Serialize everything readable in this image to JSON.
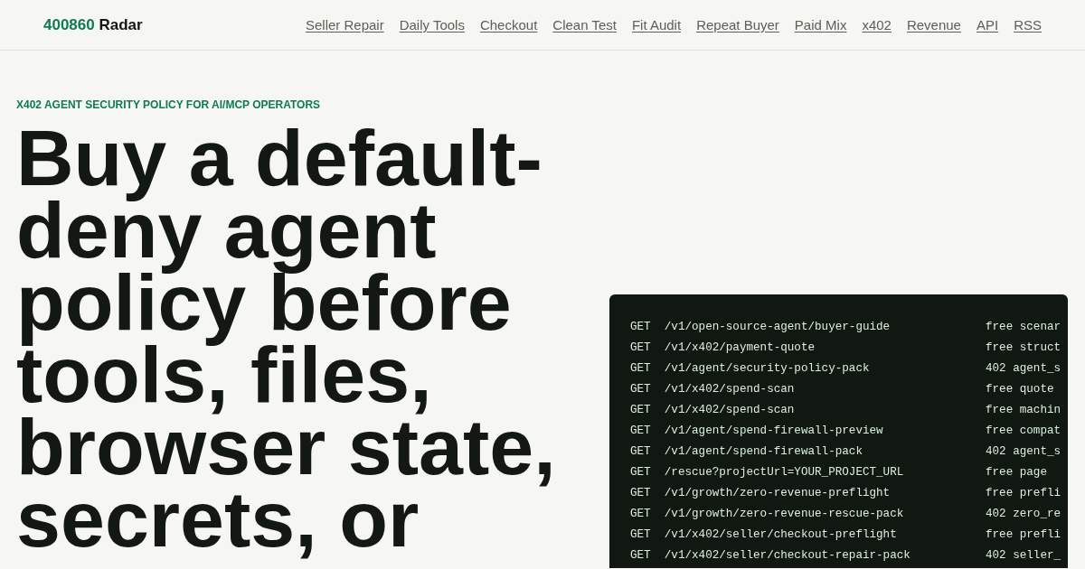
{
  "header": {
    "logo": {
      "number": "400860",
      "name": "Radar"
    },
    "nav": [
      "Seller Repair",
      "Daily Tools",
      "Checkout",
      "Clean Test",
      "Fit Audit",
      "Repeat Buyer",
      "Paid Mix",
      "x402",
      "Revenue",
      "API",
      "RSS"
    ]
  },
  "hero": {
    "eyebrow": "X402 AGENT SECURITY POLICY FOR AI/MCP OPERATORS",
    "heading": "Buy a default-deny agent policy before tools, files, browser state, secrets, or"
  },
  "code_block": {
    "lines": [
      {
        "method": "GET",
        "path": "/v1/open-source-agent/buyer-guide",
        "note": "free scenar"
      },
      {
        "method": "GET",
        "path": "/v1/x402/payment-quote",
        "note": "free struct"
      },
      {
        "method": "GET",
        "path": "/v1/agent/security-policy-pack",
        "note": "402 agent_s"
      },
      {
        "method": "GET",
        "path": "/v1/x402/spend-scan",
        "note": "free quote"
      },
      {
        "method": "GET",
        "path": "/v1/x402/spend-scan",
        "note": "free machin"
      },
      {
        "method": "GET",
        "path": "/v1/agent/spend-firewall-preview",
        "note": "free compat"
      },
      {
        "method": "GET",
        "path": "/v1/agent/spend-firewall-pack",
        "note": "402 agent_s"
      },
      {
        "method": "GET",
        "path": "/rescue?projectUrl=YOUR_PROJECT_URL",
        "note": "free page"
      },
      {
        "method": "GET",
        "path": "/v1/growth/zero-revenue-preflight",
        "note": "free prefli"
      },
      {
        "method": "GET",
        "path": "/v1/growth/zero-revenue-rescue-pack",
        "note": "402 zero_re"
      },
      {
        "method": "GET",
        "path": "/v1/x402/seller/checkout-preflight",
        "note": "free prefli"
      },
      {
        "method": "GET",
        "path": "/v1/x402/seller/checkout-repair-pack",
        "note": "402 seller_"
      }
    ]
  }
}
